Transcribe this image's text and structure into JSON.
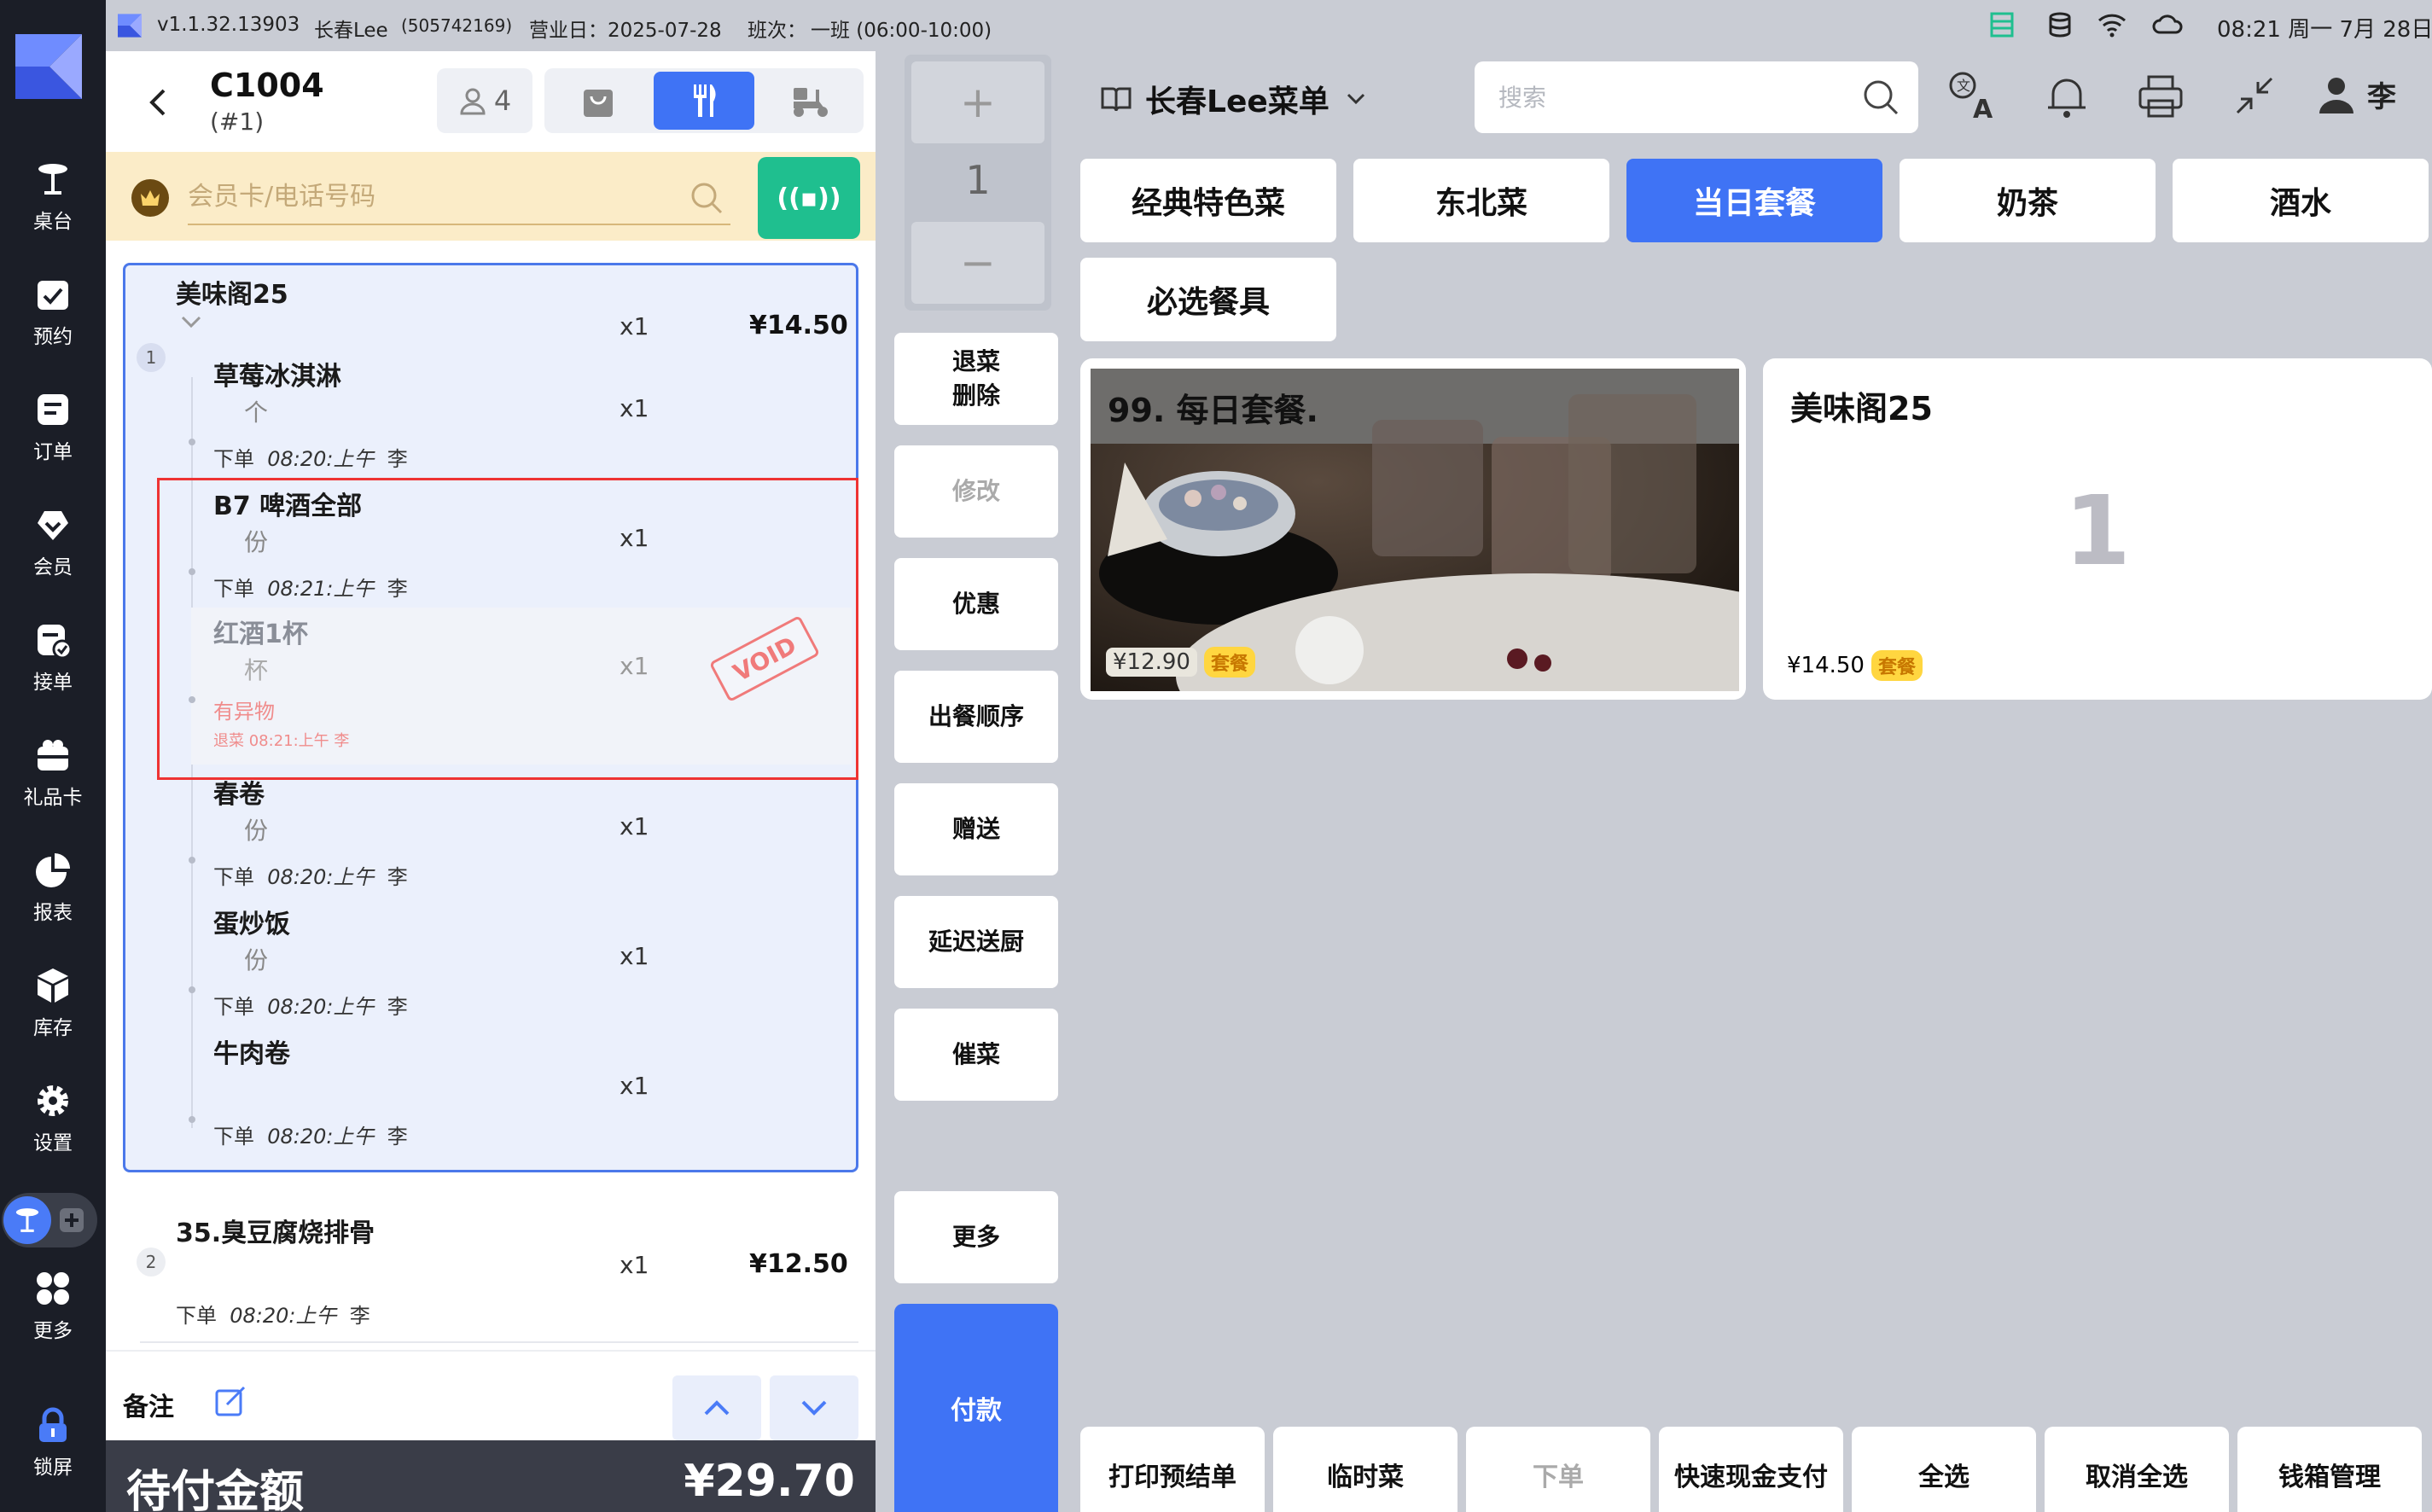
{
  "statusbar": {
    "version": "v1.1.32.13903",
    "store": "长春Lee",
    "store_id": "(505742169)",
    "business_day": "营业日：2025-07-28",
    "shift": "班次：",
    "shift_value": "一班 (06:00-10:00)",
    "clock": "08:21 周一 7月 28日"
  },
  "sidebar": {
    "items": [
      {
        "label": "桌台",
        "icon": "table-icon"
      },
      {
        "label": "预约",
        "icon": "calendar-check-icon"
      },
      {
        "label": "订单",
        "icon": "order-icon"
      },
      {
        "label": "会员",
        "icon": "member-icon"
      },
      {
        "label": "接单",
        "icon": "accept-order-icon"
      },
      {
        "label": "礼品卡",
        "icon": "gift-card-icon"
      },
      {
        "label": "报表",
        "icon": "pie-chart-icon"
      },
      {
        "label": "库存",
        "icon": "box-icon"
      },
      {
        "label": "设置",
        "icon": "gear-icon"
      },
      {
        "label": "更多",
        "icon": "grid-icon"
      },
      {
        "label": "锁屏",
        "icon": "lock-icon"
      }
    ]
  },
  "order": {
    "table_no": "C1004",
    "table_sub": "(#1)",
    "guests": "4",
    "member_placeholder": "会员卡/电话号码",
    "nfc_label": "((▪))",
    "groups": [
      {
        "index": "1",
        "name": "美味阁25",
        "qty": "x1",
        "price": "¥14.50",
        "items": [
          {
            "name": "草莓冰淇淋",
            "unit": "个",
            "qty": "x1",
            "meta_prefix": "下单",
            "time": "08:20:上午",
            "by": "李"
          },
          {
            "name": "B7 啤酒全部",
            "unit": "份",
            "qty": "x1",
            "meta_prefix": "下单",
            "time": "08:21:上午",
            "by": "李"
          },
          {
            "name": "红酒1杯",
            "unit": "杯",
            "qty": "x1",
            "reason": "有异物",
            "void_meta": "退菜  08:21:上午  李",
            "stamp": "VOID"
          },
          {
            "name": "春卷",
            "unit": "份",
            "qty": "x1",
            "meta_prefix": "下单",
            "time": "08:20:上午",
            "by": "李"
          },
          {
            "name": "蛋炒饭",
            "unit": "份",
            "qty": "x1",
            "meta_prefix": "下单",
            "time": "08:20:上午",
            "by": "李"
          },
          {
            "name": "牛肉卷",
            "unit": "",
            "qty": "x1",
            "meta_prefix": "下单",
            "time": "08:20:上午",
            "by": "李"
          }
        ]
      },
      {
        "index": "2",
        "name": "35.臭豆腐烧排骨",
        "qty": "x1",
        "price": "¥12.50",
        "meta_prefix": "下单",
        "time": "08:20:上午",
        "by": "李"
      }
    ],
    "remark_label": "备注",
    "total_label": "待付金额",
    "total_value": "¥29.70"
  },
  "actions": {
    "plus": "+",
    "qty": "1",
    "minus": "−",
    "buttons": [
      {
        "label": "退菜\n删除",
        "enabled": true
      },
      {
        "label": "修改",
        "enabled": false
      },
      {
        "label": "优惠",
        "enabled": true
      },
      {
        "label": "出餐顺序",
        "enabled": true
      },
      {
        "label": "赠送",
        "enabled": true
      },
      {
        "label": "延迟送厨",
        "enabled": true
      },
      {
        "label": "催菜",
        "enabled": true
      },
      {
        "label": "更多",
        "enabled": true
      }
    ],
    "pay": "付款"
  },
  "menu": {
    "title": "长春Lee菜单",
    "search_placeholder": "搜索",
    "user": "李",
    "categories": [
      "经典特色菜",
      "东北菜",
      "当日套餐",
      "奶茶",
      "酒水",
      "必选餐具"
    ],
    "active_category": "当日套餐",
    "products": [
      {
        "name": "99. 每日套餐.",
        "price": "¥12.90",
        "tag": "套餐"
      },
      {
        "name": "美味阁25",
        "count": "1",
        "price": "¥14.50",
        "tag": "套餐"
      }
    ],
    "bottom_buttons": [
      {
        "label": "打印预结单",
        "enabled": true
      },
      {
        "label": "临时菜",
        "enabled": true
      },
      {
        "label": "下单",
        "enabled": false
      },
      {
        "label": "快速现金支付",
        "enabled": true
      },
      {
        "label": "全选",
        "enabled": true
      },
      {
        "label": "取消全选",
        "enabled": true
      },
      {
        "label": "钱箱管理",
        "enabled": true
      }
    ]
  },
  "colors": {
    "accent": "#3f73f5",
    "sidebar": "#1b1e27",
    "member_bar": "#fbecc8",
    "nfc": "#1fbf8f",
    "void": "#f07a7a"
  }
}
